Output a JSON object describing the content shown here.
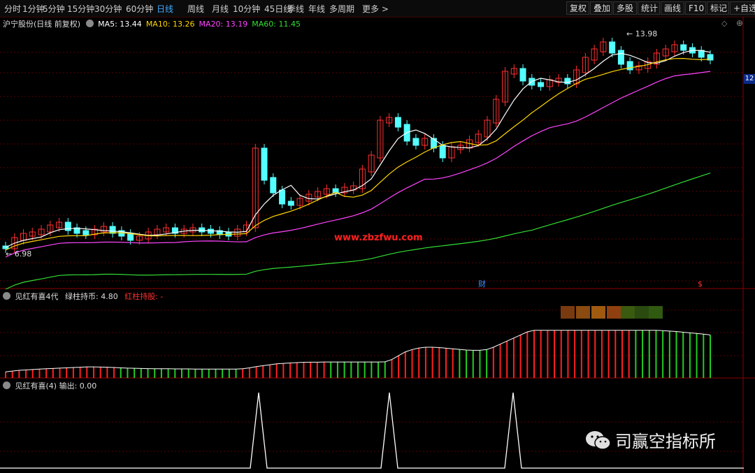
{
  "toolbar": {
    "periods": [
      "分时",
      "1分钟",
      "5分钟",
      "15分钟",
      "30分钟",
      "60分钟",
      "日线",
      "周线",
      "月线",
      "10分钟",
      "45日线",
      "季线",
      "年线",
      "多周期",
      "更多 >"
    ],
    "active_period": "日线",
    "right_buttons": [
      "复权",
      "叠加",
      "多股",
      "统计",
      "画线",
      "F10",
      "标记",
      "+自选"
    ]
  },
  "main_chart": {
    "stock_title": "沪宁股份(日线 前复权)",
    "ma_labels": [
      {
        "text": "MA5: 13.44",
        "color": "#ffffff"
      },
      {
        "text": "MA10: 13.26",
        "color": "#ffd700"
      },
      {
        "text": "MA20: 13.19",
        "color": "#ff44ff"
      },
      {
        "text": "MA60: 11.45",
        "color": "#33dd33"
      }
    ],
    "high_label": "13.98",
    "low_label": "6.98",
    "watermark": "www.zbzfwu.com",
    "price_tag": "12",
    "marker_cai": "财",
    "marker_s": "$",
    "colors": {
      "up": "#ff3030",
      "down": "#54ffff",
      "ma5": "#ffffff",
      "ma10": "#ffd700",
      "ma20": "#ff44ff",
      "ma60": "#33dd33"
    }
  },
  "indicator1": {
    "title": "见红有喜4代",
    "green_label": "绿柱持币: 4.80",
    "red_label": "红柱持股: -",
    "bars": [
      0.4,
      0.45,
      0.5,
      0.52,
      0.55,
      0.58,
      0.6,
      0.62,
      0.64,
      0.66,
      0.68,
      0.7,
      0.72,
      0.72,
      0.71,
      0.7,
      0.68,
      0.66,
      0.64,
      0.63,
      0.62,
      0.61,
      0.6,
      0.6,
      0.6,
      0.59,
      0.59,
      0.59,
      0.58,
      0.58,
      0.58,
      0.58,
      0.58,
      0.58,
      0.58,
      0.6,
      0.66,
      0.74,
      0.8,
      0.86,
      0.92,
      0.95,
      0.98,
      1.0,
      1.02,
      1.03,
      1.03,
      1.04,
      1.04,
      1.04,
      1.04,
      1.04,
      1.04,
      1.04,
      1.04,
      1.04,
      1.05,
      1.2,
      1.45,
      1.7,
      1.85,
      1.95,
      2.0,
      2.0,
      1.98,
      1.94,
      1.9,
      1.86,
      1.82,
      1.8,
      1.8,
      1.85,
      2.0,
      2.2,
      2.4,
      2.6,
      2.8,
      3.0,
      3.1,
      3.1,
      3.1,
      3.1,
      3.1,
      3.1,
      3.1,
      3.1,
      3.1,
      3.1,
      3.1,
      3.1,
      3.1,
      3.1,
      3.1,
      3.1,
      3.1,
      3.1,
      3.1,
      3.08,
      3.05,
      3.02,
      2.98,
      2.94,
      2.9,
      2.85,
      2.8
    ],
    "bar_colors_pattern": "red 0-16, green 17-34, red 35-47, green 48-56, red 57-66, green 67-71, red 72-92, green 93-104"
  },
  "indicator2": {
    "title": "见红有喜(4) 输出:",
    "value": "0.00",
    "spikes": [
      38,
      58,
      78
    ]
  },
  "brand": {
    "name": "司赢空指标所"
  }
}
